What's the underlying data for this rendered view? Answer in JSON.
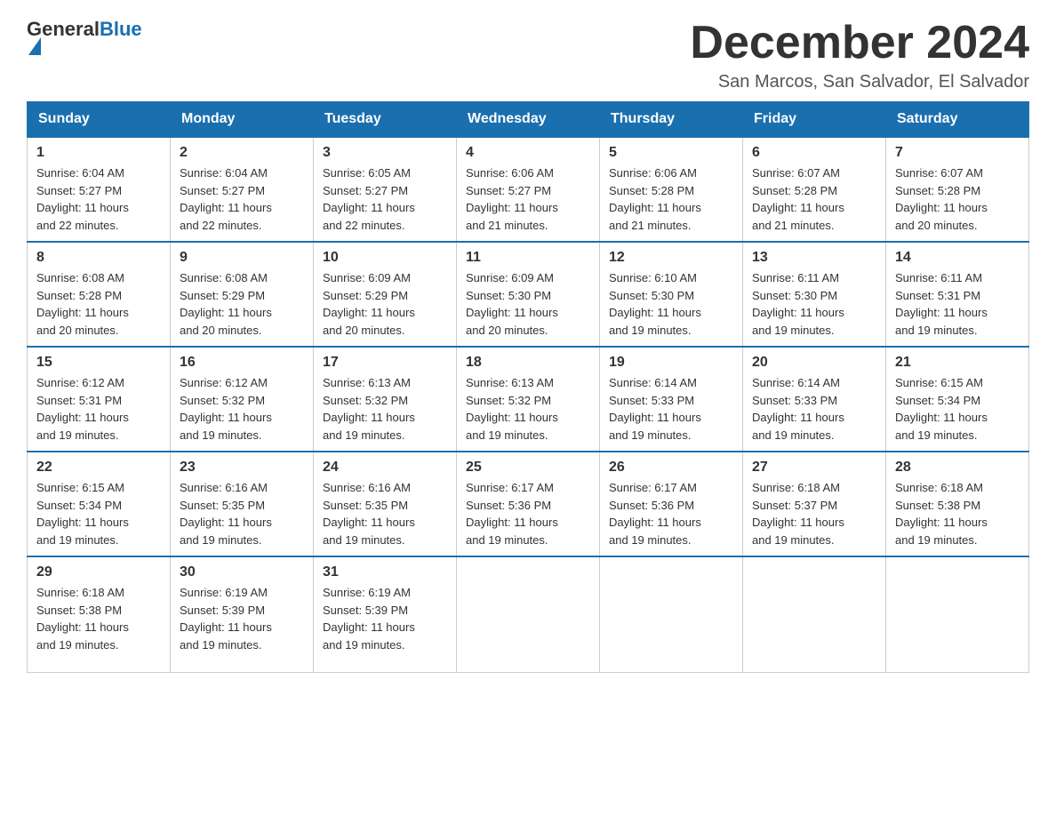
{
  "header": {
    "logo_general": "General",
    "logo_blue": "Blue",
    "month": "December 2024",
    "location": "San Marcos, San Salvador, El Salvador"
  },
  "weekdays": [
    "Sunday",
    "Monday",
    "Tuesday",
    "Wednesday",
    "Thursday",
    "Friday",
    "Saturday"
  ],
  "weeks": [
    [
      {
        "day": "1",
        "sunrise": "6:04 AM",
        "sunset": "5:27 PM",
        "daylight": "11 hours and 22 minutes."
      },
      {
        "day": "2",
        "sunrise": "6:04 AM",
        "sunset": "5:27 PM",
        "daylight": "11 hours and 22 minutes."
      },
      {
        "day": "3",
        "sunrise": "6:05 AM",
        "sunset": "5:27 PM",
        "daylight": "11 hours and 22 minutes."
      },
      {
        "day": "4",
        "sunrise": "6:06 AM",
        "sunset": "5:27 PM",
        "daylight": "11 hours and 21 minutes."
      },
      {
        "day": "5",
        "sunrise": "6:06 AM",
        "sunset": "5:28 PM",
        "daylight": "11 hours and 21 minutes."
      },
      {
        "day": "6",
        "sunrise": "6:07 AM",
        "sunset": "5:28 PM",
        "daylight": "11 hours and 21 minutes."
      },
      {
        "day": "7",
        "sunrise": "6:07 AM",
        "sunset": "5:28 PM",
        "daylight": "11 hours and 20 minutes."
      }
    ],
    [
      {
        "day": "8",
        "sunrise": "6:08 AM",
        "sunset": "5:28 PM",
        "daylight": "11 hours and 20 minutes."
      },
      {
        "day": "9",
        "sunrise": "6:08 AM",
        "sunset": "5:29 PM",
        "daylight": "11 hours and 20 minutes."
      },
      {
        "day": "10",
        "sunrise": "6:09 AM",
        "sunset": "5:29 PM",
        "daylight": "11 hours and 20 minutes."
      },
      {
        "day": "11",
        "sunrise": "6:09 AM",
        "sunset": "5:30 PM",
        "daylight": "11 hours and 20 minutes."
      },
      {
        "day": "12",
        "sunrise": "6:10 AM",
        "sunset": "5:30 PM",
        "daylight": "11 hours and 19 minutes."
      },
      {
        "day": "13",
        "sunrise": "6:11 AM",
        "sunset": "5:30 PM",
        "daylight": "11 hours and 19 minutes."
      },
      {
        "day": "14",
        "sunrise": "6:11 AM",
        "sunset": "5:31 PM",
        "daylight": "11 hours and 19 minutes."
      }
    ],
    [
      {
        "day": "15",
        "sunrise": "6:12 AM",
        "sunset": "5:31 PM",
        "daylight": "11 hours and 19 minutes."
      },
      {
        "day": "16",
        "sunrise": "6:12 AM",
        "sunset": "5:32 PM",
        "daylight": "11 hours and 19 minutes."
      },
      {
        "day": "17",
        "sunrise": "6:13 AM",
        "sunset": "5:32 PM",
        "daylight": "11 hours and 19 minutes."
      },
      {
        "day": "18",
        "sunrise": "6:13 AM",
        "sunset": "5:32 PM",
        "daylight": "11 hours and 19 minutes."
      },
      {
        "day": "19",
        "sunrise": "6:14 AM",
        "sunset": "5:33 PM",
        "daylight": "11 hours and 19 minutes."
      },
      {
        "day": "20",
        "sunrise": "6:14 AM",
        "sunset": "5:33 PM",
        "daylight": "11 hours and 19 minutes."
      },
      {
        "day": "21",
        "sunrise": "6:15 AM",
        "sunset": "5:34 PM",
        "daylight": "11 hours and 19 minutes."
      }
    ],
    [
      {
        "day": "22",
        "sunrise": "6:15 AM",
        "sunset": "5:34 PM",
        "daylight": "11 hours and 19 minutes."
      },
      {
        "day": "23",
        "sunrise": "6:16 AM",
        "sunset": "5:35 PM",
        "daylight": "11 hours and 19 minutes."
      },
      {
        "day": "24",
        "sunrise": "6:16 AM",
        "sunset": "5:35 PM",
        "daylight": "11 hours and 19 minutes."
      },
      {
        "day": "25",
        "sunrise": "6:17 AM",
        "sunset": "5:36 PM",
        "daylight": "11 hours and 19 minutes."
      },
      {
        "day": "26",
        "sunrise": "6:17 AM",
        "sunset": "5:36 PM",
        "daylight": "11 hours and 19 minutes."
      },
      {
        "day": "27",
        "sunrise": "6:18 AM",
        "sunset": "5:37 PM",
        "daylight": "11 hours and 19 minutes."
      },
      {
        "day": "28",
        "sunrise": "6:18 AM",
        "sunset": "5:38 PM",
        "daylight": "11 hours and 19 minutes."
      }
    ],
    [
      {
        "day": "29",
        "sunrise": "6:18 AM",
        "sunset": "5:38 PM",
        "daylight": "11 hours and 19 minutes."
      },
      {
        "day": "30",
        "sunrise": "6:19 AM",
        "sunset": "5:39 PM",
        "daylight": "11 hours and 19 minutes."
      },
      {
        "day": "31",
        "sunrise": "6:19 AM",
        "sunset": "5:39 PM",
        "daylight": "11 hours and 19 minutes."
      },
      null,
      null,
      null,
      null
    ]
  ],
  "labels": {
    "sunrise": "Sunrise:",
    "sunset": "Sunset:",
    "daylight": "Daylight:"
  }
}
